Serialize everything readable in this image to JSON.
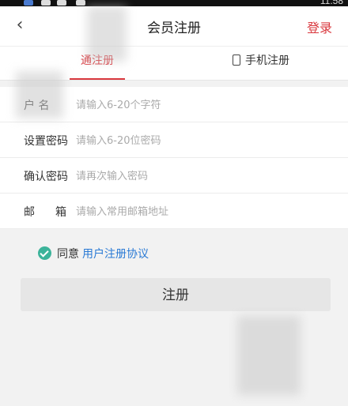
{
  "status_bar": {
    "time": "11:58"
  },
  "header": {
    "back_icon": "chevron-left-icon",
    "title": "会员注册",
    "login_label": "登录",
    "accent_color": "#d9383e"
  },
  "tabs": [
    {
      "label": "通注册",
      "active": true
    },
    {
      "label": "手机注册",
      "active": false,
      "icon": "phone-icon"
    }
  ],
  "form": {
    "fields": [
      {
        "label": "户 名",
        "placeholder": "请输入6-20个字符"
      },
      {
        "label": "设置密码",
        "placeholder": "请输入6-20位密码"
      },
      {
        "label": "确认密码",
        "placeholder": "请再次输入密码"
      },
      {
        "label": "邮箱",
        "placeholder": "请输入常用邮箱地址"
      }
    ]
  },
  "agreement": {
    "checked": true,
    "check_icon": "check-circle-icon",
    "prefix": "同意",
    "link": "用户注册协议",
    "check_color": "#3cb39a",
    "link_color": "#2a7ad5"
  },
  "register_button": {
    "label": "注册"
  }
}
